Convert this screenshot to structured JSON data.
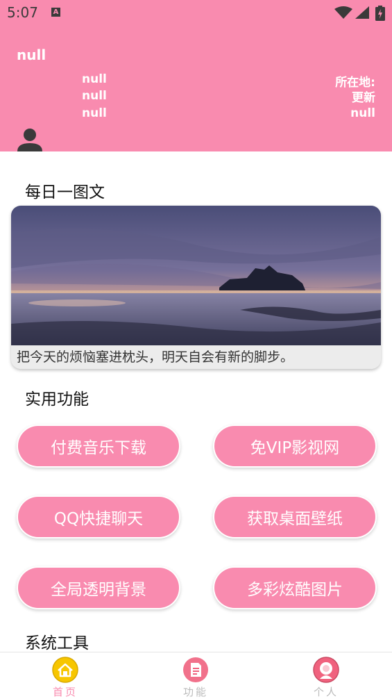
{
  "status_bar": {
    "time": "5:07",
    "notification_icon": "a-icon",
    "icons": [
      "wifi-icon",
      "signal-icon",
      "battery-icon"
    ]
  },
  "header": {
    "name": "null",
    "lines_left": [
      "null",
      "null",
      "null"
    ],
    "location_label": "所在地:",
    "refresh_label": "更新",
    "location_value": "null",
    "background_color": "#f98baf"
  },
  "daily": {
    "title": "每日一图文",
    "caption": "把今天的烦恼塞进枕头，明天自会有新的脚步。"
  },
  "features": {
    "title": "实用功能",
    "buttons": [
      "付费音乐下载",
      "免VIP影视网",
      "QQ快捷聊天",
      "获取桌面壁纸",
      "全局透明背景",
      "多彩炫酷图片"
    ]
  },
  "system_tools": {
    "title": "系统工具"
  },
  "bottom_nav": {
    "items": [
      {
        "label": "首页",
        "icon": "home-icon",
        "active": true,
        "color": "#f7c600"
      },
      {
        "label": "功能",
        "icon": "document-icon",
        "active": false,
        "color": "#f0627e"
      },
      {
        "label": "个人",
        "icon": "person-icon",
        "active": false,
        "color": "#f0627e"
      }
    ],
    "active_color": "#f98baf",
    "inactive_color": "#bbbbbb"
  }
}
